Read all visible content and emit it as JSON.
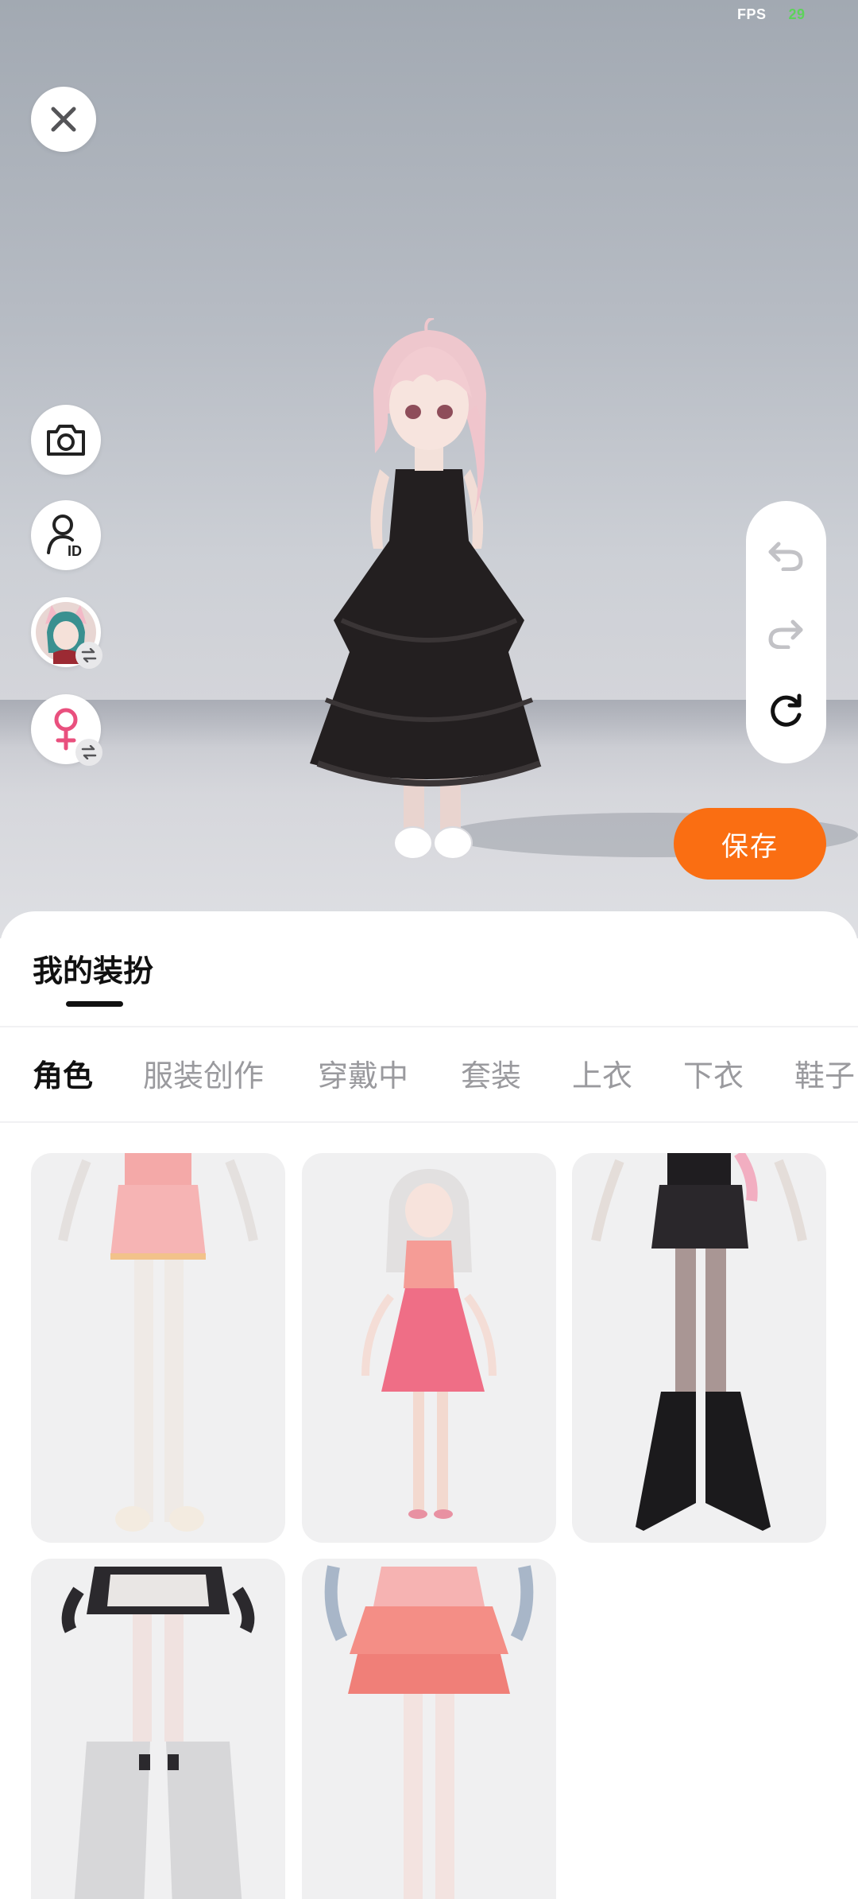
{
  "status": {
    "fps_label": "FPS",
    "fps_value": "29"
  },
  "toolbar": {
    "close_icon": "close-icon",
    "camera_icon": "camera-icon",
    "id_icon": "profile-id-icon",
    "avatar_icon": "avatar-switch-icon",
    "gender_icon": "female-icon"
  },
  "history": {
    "undo_icon": "undo-icon",
    "redo_icon": "redo-icon",
    "reset_icon": "reset-icon"
  },
  "save_button": {
    "label": "保存"
  },
  "sheet": {
    "title": "我的装扮",
    "tabs": [
      "角色",
      "服装创作",
      "穿戴中",
      "套装",
      "上衣",
      "下衣",
      "鞋子"
    ],
    "active_tab": "角色"
  },
  "colors": {
    "accent": "#fa6e12",
    "gender_pink": "#e9507e",
    "fps_green": "#5dd35a"
  }
}
